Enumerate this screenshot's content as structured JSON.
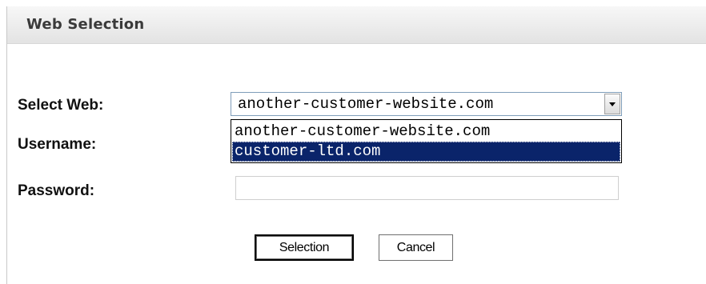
{
  "panel": {
    "title": "Web Selection"
  },
  "form": {
    "select_web_label": "Select Web:",
    "username_label": "Username:",
    "password_label": "Password:",
    "web_select": {
      "value": "another-customer-website.com",
      "options": [
        "another-customer-website.com",
        "customer-ltd.com"
      ],
      "highlighted_option_index": 1
    },
    "password": {
      "value": "",
      "placeholder": ""
    }
  },
  "buttons": {
    "selection_label": "Selection",
    "cancel_label": "Cancel"
  },
  "colors": {
    "highlight_background": "#0a246a",
    "highlight_text": "#ffffff",
    "header_background": "#ececec",
    "title_text": "#3a3a3a"
  },
  "icons": {
    "dropdown_arrow": "chevron-down-icon"
  }
}
